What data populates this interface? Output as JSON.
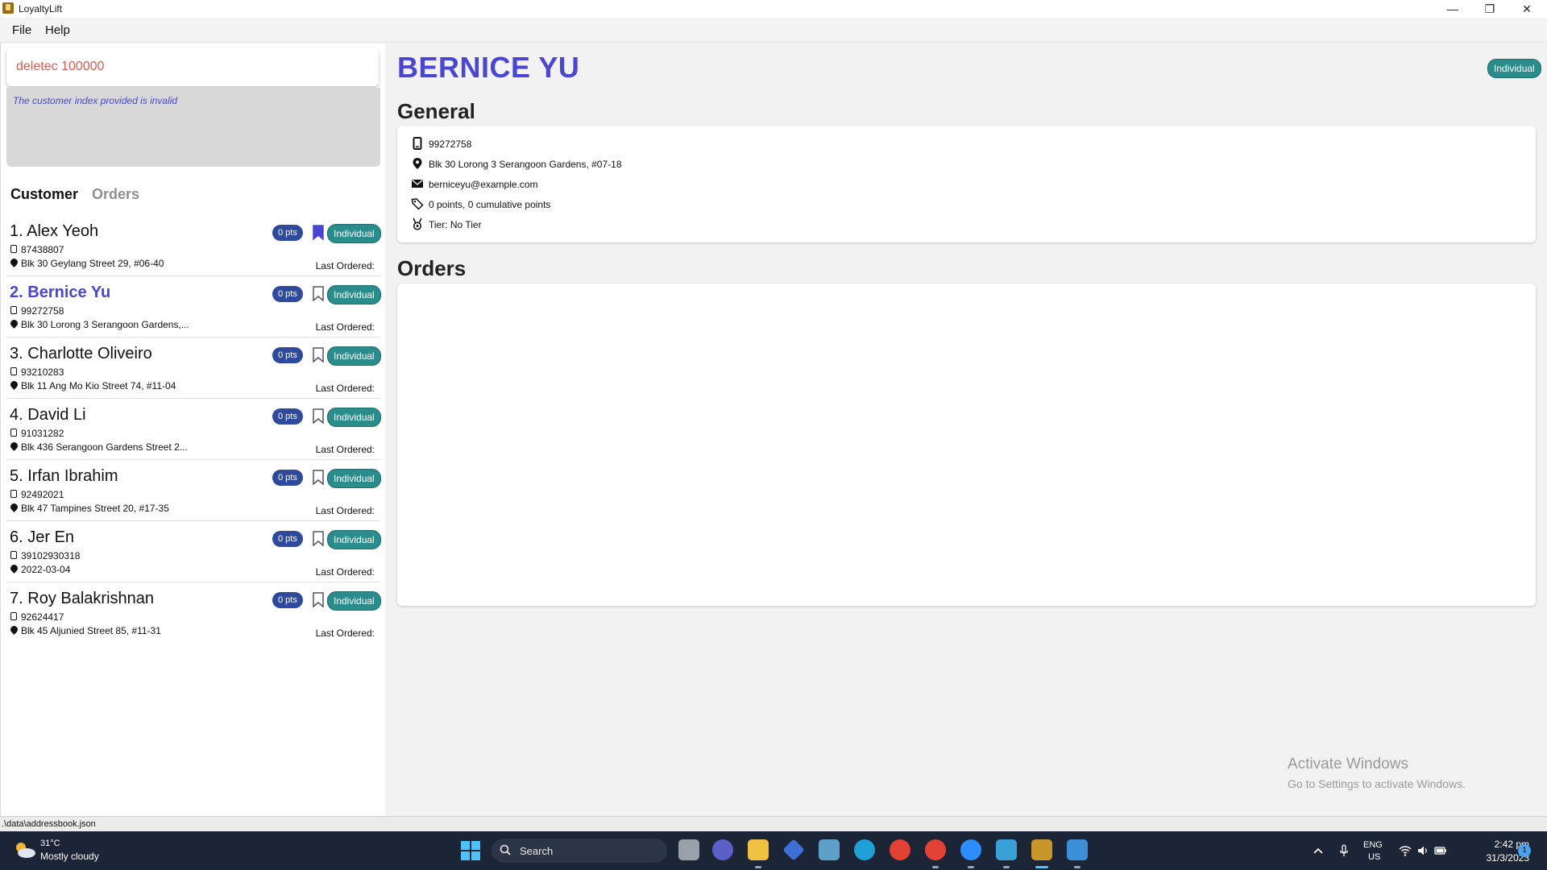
{
  "window": {
    "title": "LoyaltyLift",
    "minimize": "—",
    "maximize": "❐",
    "close": "✕"
  },
  "menu": {
    "file": "File",
    "help": "Help"
  },
  "command": {
    "value": "deletec 100000",
    "result": "The customer index provided is invalid"
  },
  "tabs": {
    "customer": "Customer",
    "orders": "Orders"
  },
  "customers": [
    {
      "index": "1.",
      "name": "Alex Yeoh",
      "phone": "87438807",
      "address": "Blk 30 Geylang Street 29, #06-40",
      "points": "0 pts",
      "tier": "Individual",
      "bookmarked": true,
      "last_ordered": "Last Ordered:"
    },
    {
      "index": "2.",
      "name": "Bernice Yu",
      "phone": "99272758",
      "address": "Blk 30 Lorong 3 Serangoon Gardens,...",
      "points": "0 pts",
      "tier": "Individual",
      "bookmarked": false,
      "last_ordered": "Last Ordered:"
    },
    {
      "index": "3.",
      "name": "Charlotte Oliveiro",
      "phone": "93210283",
      "address": "Blk 11 Ang Mo Kio Street 74, #11-04",
      "points": "0 pts",
      "tier": "Individual",
      "bookmarked": false,
      "last_ordered": "Last Ordered:"
    },
    {
      "index": "4.",
      "name": "David Li",
      "phone": "91031282",
      "address": "Blk 436 Serangoon Gardens Street 2...",
      "points": "0 pts",
      "tier": "Individual",
      "bookmarked": false,
      "last_ordered": "Last Ordered:"
    },
    {
      "index": "5.",
      "name": "Irfan Ibrahim",
      "phone": "92492021",
      "address": "Blk 47 Tampines Street 20, #17-35",
      "points": "0 pts",
      "tier": "Individual",
      "bookmarked": false,
      "last_ordered": "Last Ordered:"
    },
    {
      "index": "6.",
      "name": "Jer En",
      "phone": "39102930318",
      "address": "2022-03-04",
      "points": "0 pts",
      "tier": "Individual",
      "bookmarked": false,
      "last_ordered": "Last Ordered:"
    },
    {
      "index": "7.",
      "name": "Roy Balakrishnan",
      "phone": "92624417",
      "address": "Blk 45 Aljunied Street 85, #11-31",
      "points": "0 pts",
      "tier": "Individual",
      "bookmarked": false,
      "last_ordered": "Last Ordered:"
    }
  ],
  "detail": {
    "name": "BERNICE YU",
    "tier": "Individual",
    "general_title": "General",
    "phone": "99272758",
    "address": "Blk 30 Lorong 3 Serangoon Gardens, #07-18",
    "email": "berniceyu@example.com",
    "points": "0 points, 0 cumulative points",
    "tier_line": "Tier: No Tier",
    "orders_title": "Orders"
  },
  "watermark": {
    "line1": "Activate Windows",
    "line2": "Go to Settings to activate Windows."
  },
  "status": {
    "path": ".\\data\\addressbook.json"
  },
  "taskbar": {
    "weather_temp": "31°C",
    "weather_desc": "Mostly cloudy",
    "search": "Search",
    "lang": "ENG",
    "region": "US",
    "time": "2:42 pm",
    "date": "31/3/2023",
    "notifications": "1"
  },
  "colors": {
    "accent": "#4a45d4",
    "points_badge": "#2f4a9c",
    "tier_badge": "#2b8c8c",
    "error": "#e05a4e",
    "taskbar": "#1c2536"
  }
}
